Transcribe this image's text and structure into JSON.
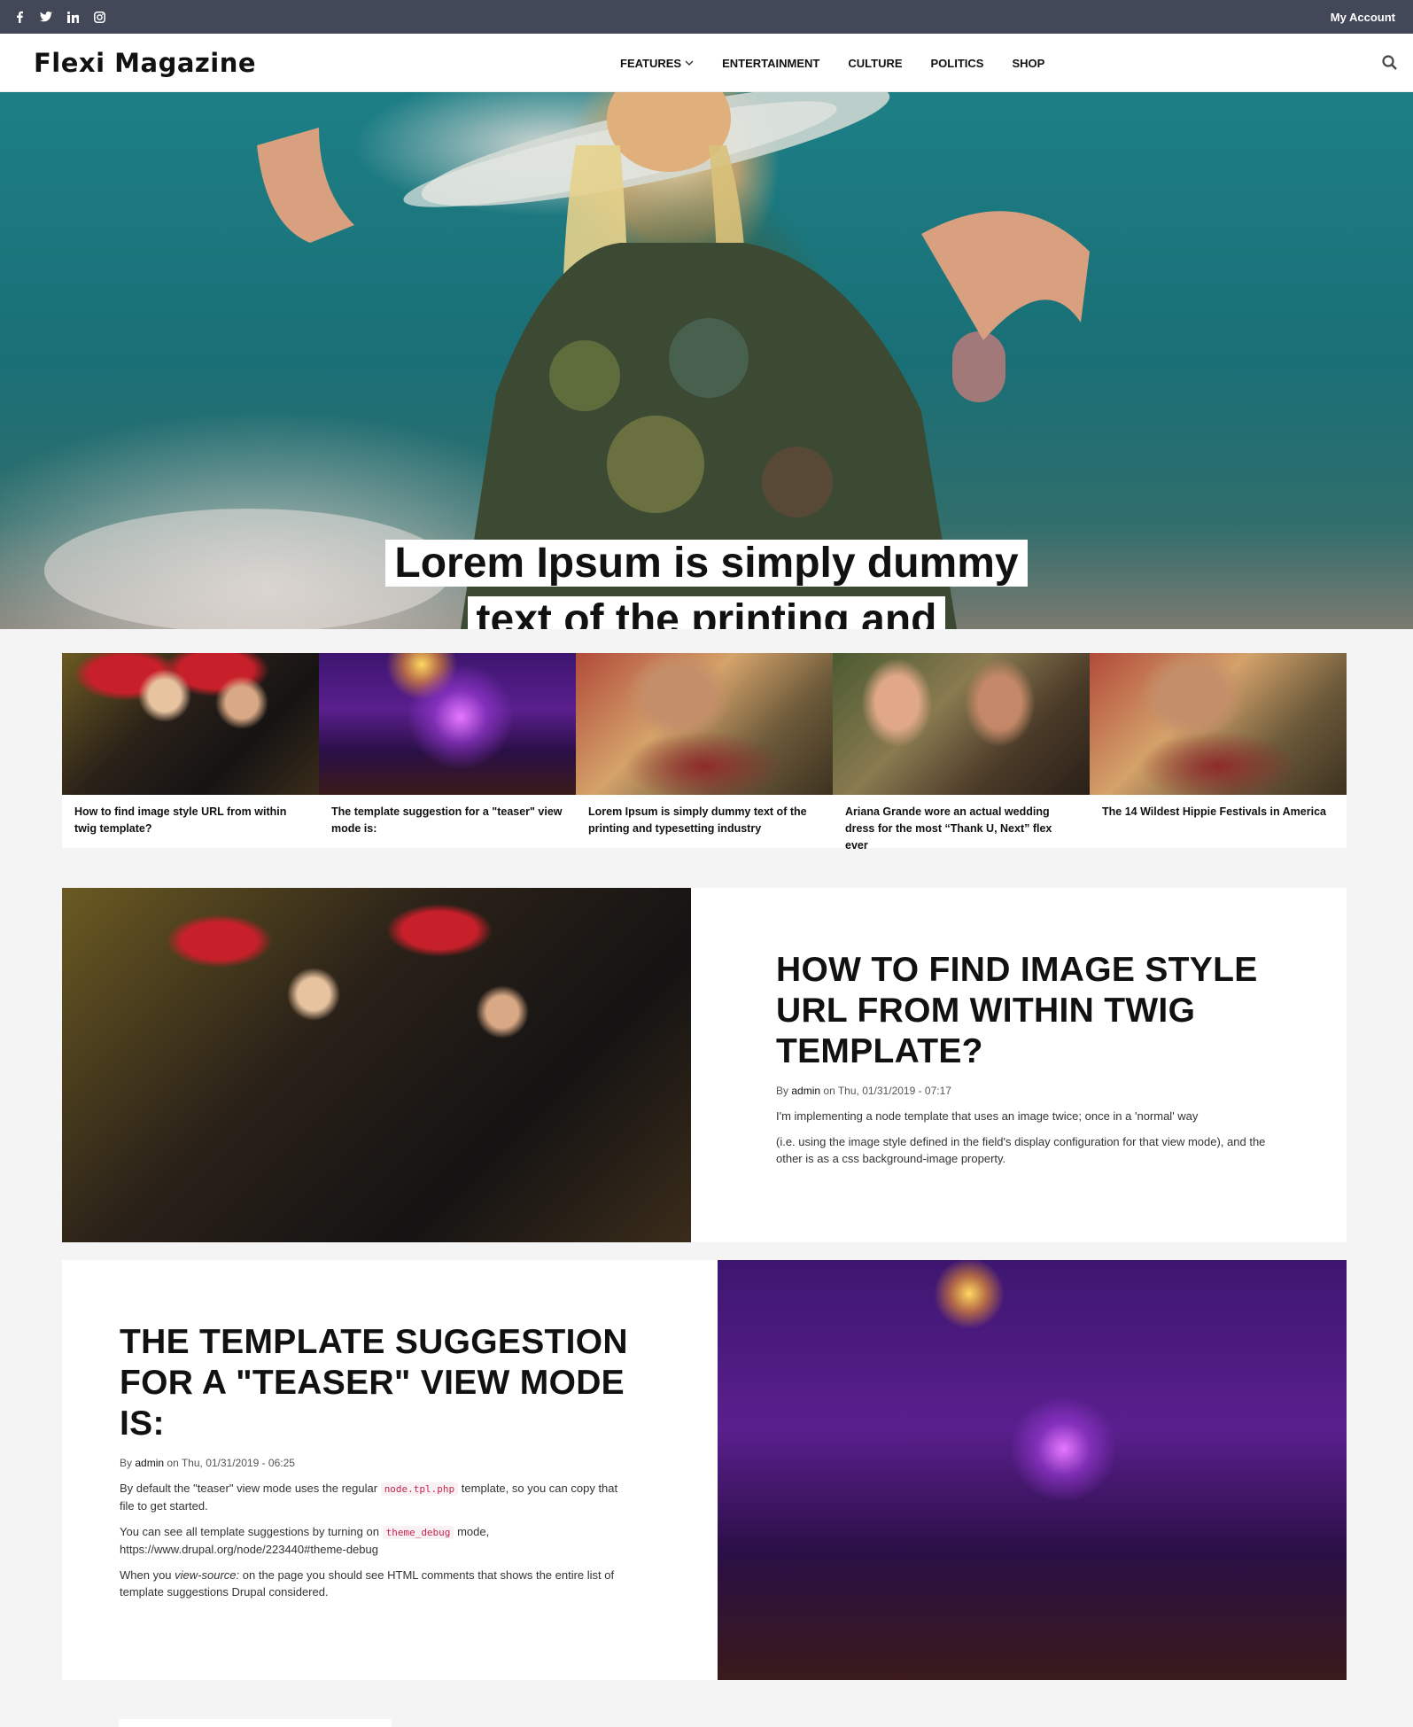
{
  "topbar": {
    "social": [
      "f",
      "t",
      "in",
      "ig"
    ],
    "social_icons": [
      "facebook-icon",
      "twitter-icon",
      "linkedin-icon",
      "instagram-icon"
    ],
    "account_label": "My Account"
  },
  "header": {
    "logo": "Flexi Magazine",
    "nav": [
      "FEATURES",
      "ENTERTAINMENT",
      "CULTURE",
      "POLITICS",
      "SHOP"
    ]
  },
  "hero": {
    "title": "Lorem Ipsum is simply dummy text of the printing and typesetting industry."
  },
  "strip": [
    {
      "title": "How to find image style URL from within twig template?"
    },
    {
      "title": "The template suggestion for a \"teaser\" view mode is:"
    },
    {
      "title": "Lorem Ipsum is simply dummy text of the printing and typesetting industry"
    },
    {
      "title": "Ariana Grande wore an actual wedding dress for the most “Thank U, Next” flex ever"
    },
    {
      "title": "The 14 Wildest Hippie Festivals in America"
    }
  ],
  "article1": {
    "title": "HOW TO FIND IMAGE STYLE URL FROM WITHIN TWIG TEMPLATE?",
    "by": "By",
    "author": "admin",
    "date": "on Thu, 01/31/2019 - 07:17",
    "p1": "I'm implementing a node template that uses an image twice; once in a 'normal' way",
    "p2": "(i.e. using the image style defined in the field's display configuration for that view mode), and the other is as a css background-image property."
  },
  "article2": {
    "title": "THE TEMPLATE SUGGESTION FOR A \"TEASER\" VIEW MODE IS:",
    "by": "By",
    "author": "admin",
    "date": "on Thu, 01/31/2019 - 06:25",
    "p1_a": "By default the \"teaser\" view mode uses the regular",
    "p1_code": "node.tpl.php",
    "p1_b": "template, so you can copy that file to get started.",
    "p2_a": "You can see all template suggestions by turning on",
    "p2_code": "theme_debug",
    "p2_b": "mode, https://www.drupal.org/node/223440#theme-debug",
    "p3_a": "When you",
    "p3_em": "view-source:",
    "p3_b": "on the page you should see HTML comments that shows the entire list of template suggestions Drupal considered."
  },
  "colors": {
    "topbar": "#424857",
    "code": "#c7254e",
    "background": "#f4f4f4"
  }
}
